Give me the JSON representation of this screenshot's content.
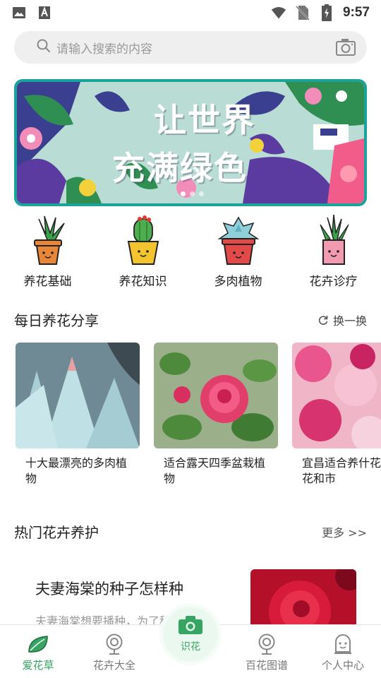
{
  "status_bar": {
    "time": "9:57"
  },
  "search": {
    "placeholder": "请输入搜索的内容"
  },
  "banner": {
    "line1": "让世界",
    "line2": "充满绿色"
  },
  "categories": [
    {
      "label": "养花基础",
      "icon": "pot-leafy-plant-icon",
      "pot_color": "#e8863a"
    },
    {
      "label": "养花知识",
      "icon": "pot-cactus-icon",
      "pot_color": "#f3c42e"
    },
    {
      "label": "多肉植物",
      "icon": "pot-succulent-icon",
      "pot_color": "#e24a4a"
    },
    {
      "label": "花卉诊疗",
      "icon": "pot-grass-icon",
      "pot_color": "#f29ab0"
    }
  ],
  "daily_share": {
    "title": "每日养花分享",
    "refresh_label": "换一换",
    "cards": [
      {
        "caption": "十大最漂亮的多肉植物"
      },
      {
        "caption": "适合露天四季盆栽植物"
      },
      {
        "caption": "宜昌适合养什花，市花和市"
      }
    ]
  },
  "hot_care": {
    "title": "热门花卉养护",
    "more_label": "更多 >>",
    "items": [
      {
        "title": "夫妻海棠的种子怎样种",
        "desc": "夫妻海棠想要播种，为了种子的"
      }
    ]
  },
  "tabbar": {
    "tabs": [
      {
        "label": "爱花草",
        "active": true
      },
      {
        "label": "花卉大全",
        "active": false
      },
      {
        "label": "识花",
        "active": false
      },
      {
        "label": "百花图谱",
        "active": false
      },
      {
        "label": "个人中心",
        "active": false
      }
    ]
  },
  "colors": {
    "accent_green": "#36a463",
    "banner_border": "#1aa39a"
  }
}
